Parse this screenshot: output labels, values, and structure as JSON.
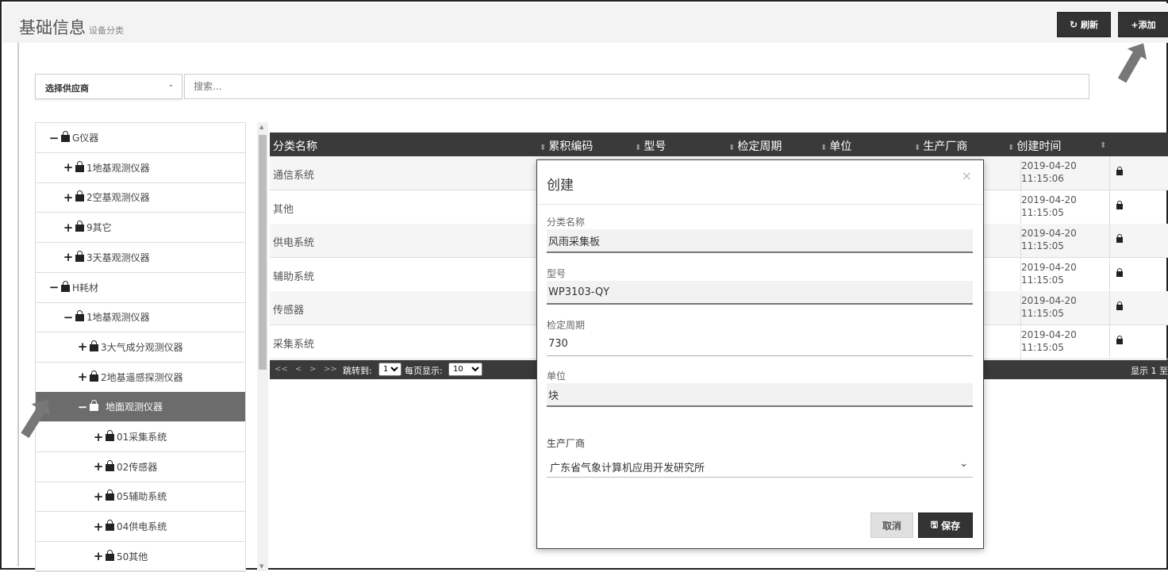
{
  "header": {
    "title": "基础信息",
    "subtitle": "设备分类",
    "refresh_label": "刷新",
    "refresh_icon": "↻",
    "add_label": "+添加"
  },
  "filters": {
    "supplier_label": "选择供应商",
    "search_placeholder": "搜索..."
  },
  "tree": {
    "items": [
      {
        "sym": "−",
        "label": "G仪器"
      },
      {
        "sym": "+",
        "label": "1地基观测仪器"
      },
      {
        "sym": "+",
        "label": "2空基观测仪器"
      },
      {
        "sym": "+",
        "label": "9其它"
      },
      {
        "sym": "+",
        "label": "3天基观测仪器"
      },
      {
        "sym": "−",
        "label": "H耗材"
      },
      {
        "sym": "−",
        "label": "1地基观测仪器"
      },
      {
        "sym": "+",
        "label": "3大气成分观测仪器"
      },
      {
        "sym": "+",
        "label": "2地基遥感探测仪器"
      },
      {
        "sym": "−",
        "label": "地面观测仪器"
      },
      {
        "sym": "+",
        "label": "01采集系统"
      },
      {
        "sym": "+",
        "label": "02传感器"
      },
      {
        "sym": "+",
        "label": "05辅助系统"
      },
      {
        "sym": "+",
        "label": "04供电系统"
      },
      {
        "sym": "+",
        "label": "50其他"
      }
    ]
  },
  "table": {
    "sort_icon": "⬍",
    "columns": [
      "分类名称",
      "累积编码",
      "型号",
      "检定周期",
      "单位",
      "生产厂商",
      "创建时间"
    ],
    "rows": [
      {
        "name": "通信系统",
        "date": "2019-04-20",
        "time": "11:15:06"
      },
      {
        "name": "其他",
        "date": "2019-04-20",
        "time": "11:15:05"
      },
      {
        "name": "供电系统",
        "date": "2019-04-20",
        "time": "11:15:05"
      },
      {
        "name": "辅助系统",
        "date": "2019-04-20",
        "time": "11:15:05"
      },
      {
        "name": "传感器",
        "date": "2019-04-20",
        "time": "11:15:05"
      },
      {
        "name": "采集系统",
        "date": "2019-04-20",
        "time": "11:15:05"
      }
    ],
    "pager": {
      "first": "<<",
      "prev": "<",
      "next": ">",
      "last": ">>",
      "jump_label": "跳转到:",
      "page_value": "1",
      "per_page_label": "每页显示:",
      "per_page_value": "10",
      "showing": "显示 1 至"
    }
  },
  "modal": {
    "title": "创建",
    "close": "×",
    "fields": [
      {
        "label": "分类名称",
        "value": "风雨采集板"
      },
      {
        "label": "型号",
        "value": "WP3103-QY"
      },
      {
        "label": "检定周期",
        "value": "730"
      },
      {
        "label": "单位",
        "value": "块"
      }
    ],
    "manufacturer_label": "生产厂商",
    "manufacturer_value": "广东省气象计算机应用开发研究所",
    "cancel_label": "取消",
    "save_label": "保存",
    "save_icon": "🖫"
  }
}
